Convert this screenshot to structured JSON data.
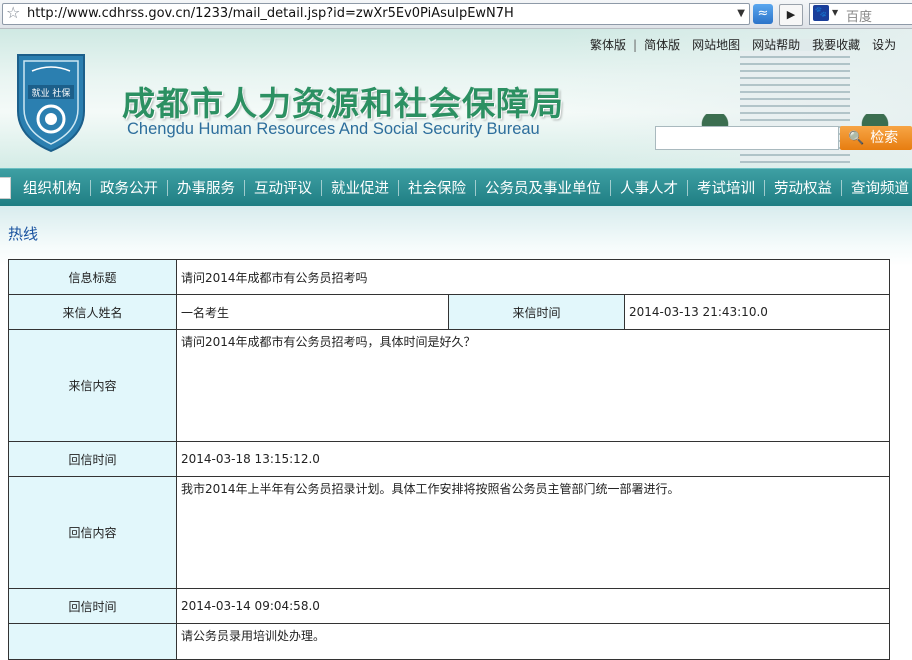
{
  "browser": {
    "url": "http://www.cdhrss.gov.cn/1233/mail_detail.jsp?id=zwXr5Ev0PiAsuIpEwN7H",
    "search_placeholder": "百度"
  },
  "header": {
    "title": "成都市人力资源和社会保障局",
    "subtitle": "Chengdu Human Resources And Social Security Bureau",
    "logo_text": "就业 社保",
    "top_links": [
      "繁体版",
      "简体版",
      "网站地图",
      "网站帮助",
      "我要收藏",
      "设为"
    ],
    "search_button": "检索"
  },
  "nav": {
    "items": [
      "组织机构",
      "政务公开",
      "办事服务",
      "互动评议",
      "就业促进",
      "社会保险",
      "公务员及事业单位",
      "人事人才",
      "考试培训",
      "劳动权益",
      "查询频道"
    ]
  },
  "section": {
    "title": "热线"
  },
  "detail": {
    "subject_label": "信息标题",
    "subject": "请问2014年成都市有公务员招考吗",
    "sender_label": "来信人姓名",
    "sender": "一名考生",
    "sent_time_label": "来信时间",
    "sent_time": "2014-03-13 21:43:10.0",
    "content_label": "来信内容",
    "content": "请问2014年成都市有公务员招考吗，具体时间是好久？",
    "reply_time_label": "回信时间",
    "reply_time": "2014-03-18 13:15:12.0",
    "reply_content_label": "回信内容",
    "reply_content": "我市2014年上半年有公务员招录计划。具体工作安排将按照省公务员主管部门统一部署进行。",
    "reply_time2_label": "回信时间",
    "reply_time2": "2014-03-14 09:04:58.0",
    "reply_content2": "请公务员录用培训处办理。"
  },
  "colors": {
    "title_green": "#2c9062",
    "nav_teal": "#2a8d91",
    "label_bg": "#e2f7fb",
    "section_blue": "#1a53a0"
  }
}
